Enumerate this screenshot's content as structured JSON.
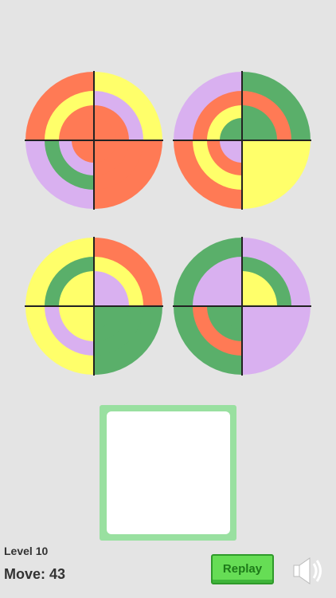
{
  "palette": {
    "orange": "#ff7a55",
    "yellow": "#ffff6a",
    "lavender": "#d9b0f0",
    "green": "#5aaf6a",
    "divider": "#222222"
  },
  "puzzles": [
    {
      "quadrants": [
        [
          "orange",
          "yellow",
          "orange",
          "orange"
        ],
        [
          "yellow",
          "lavender",
          "orange",
          "orange"
        ],
        [
          "lavender",
          "green",
          "lavender",
          "orange"
        ],
        [
          "orange",
          "orange",
          "orange",
          "orange"
        ]
      ]
    },
    {
      "quadrants": [
        [
          "lavender",
          "orange",
          "yellow",
          "green"
        ],
        [
          "green",
          "orange",
          "green",
          "green"
        ],
        [
          "orange",
          "yellow",
          "orange",
          "lavender"
        ],
        [
          "yellow",
          "yellow",
          "yellow",
          "yellow"
        ]
      ]
    },
    {
      "quadrants": [
        [
          "yellow",
          "green",
          "yellow",
          "yellow"
        ],
        [
          "orange",
          "yellow",
          "lavender",
          "lavender"
        ],
        [
          "yellow",
          "lavender",
          "yellow",
          "yellow"
        ],
        [
          "green",
          "green",
          "green",
          "green"
        ]
      ]
    },
    {
      "quadrants": [
        [
          "green",
          "lavender",
          "lavender",
          "lavender"
        ],
        [
          "lavender",
          "green",
          "yellow",
          "yellow"
        ],
        [
          "green",
          "orange",
          "green",
          "green"
        ],
        [
          "lavender",
          "lavender",
          "lavender",
          "lavender"
        ]
      ]
    }
  ],
  "status": {
    "level": "Level 10",
    "moves": "Move: 43"
  },
  "controls": {
    "replay_label": "Replay",
    "sound_icon": "speaker-icon"
  }
}
